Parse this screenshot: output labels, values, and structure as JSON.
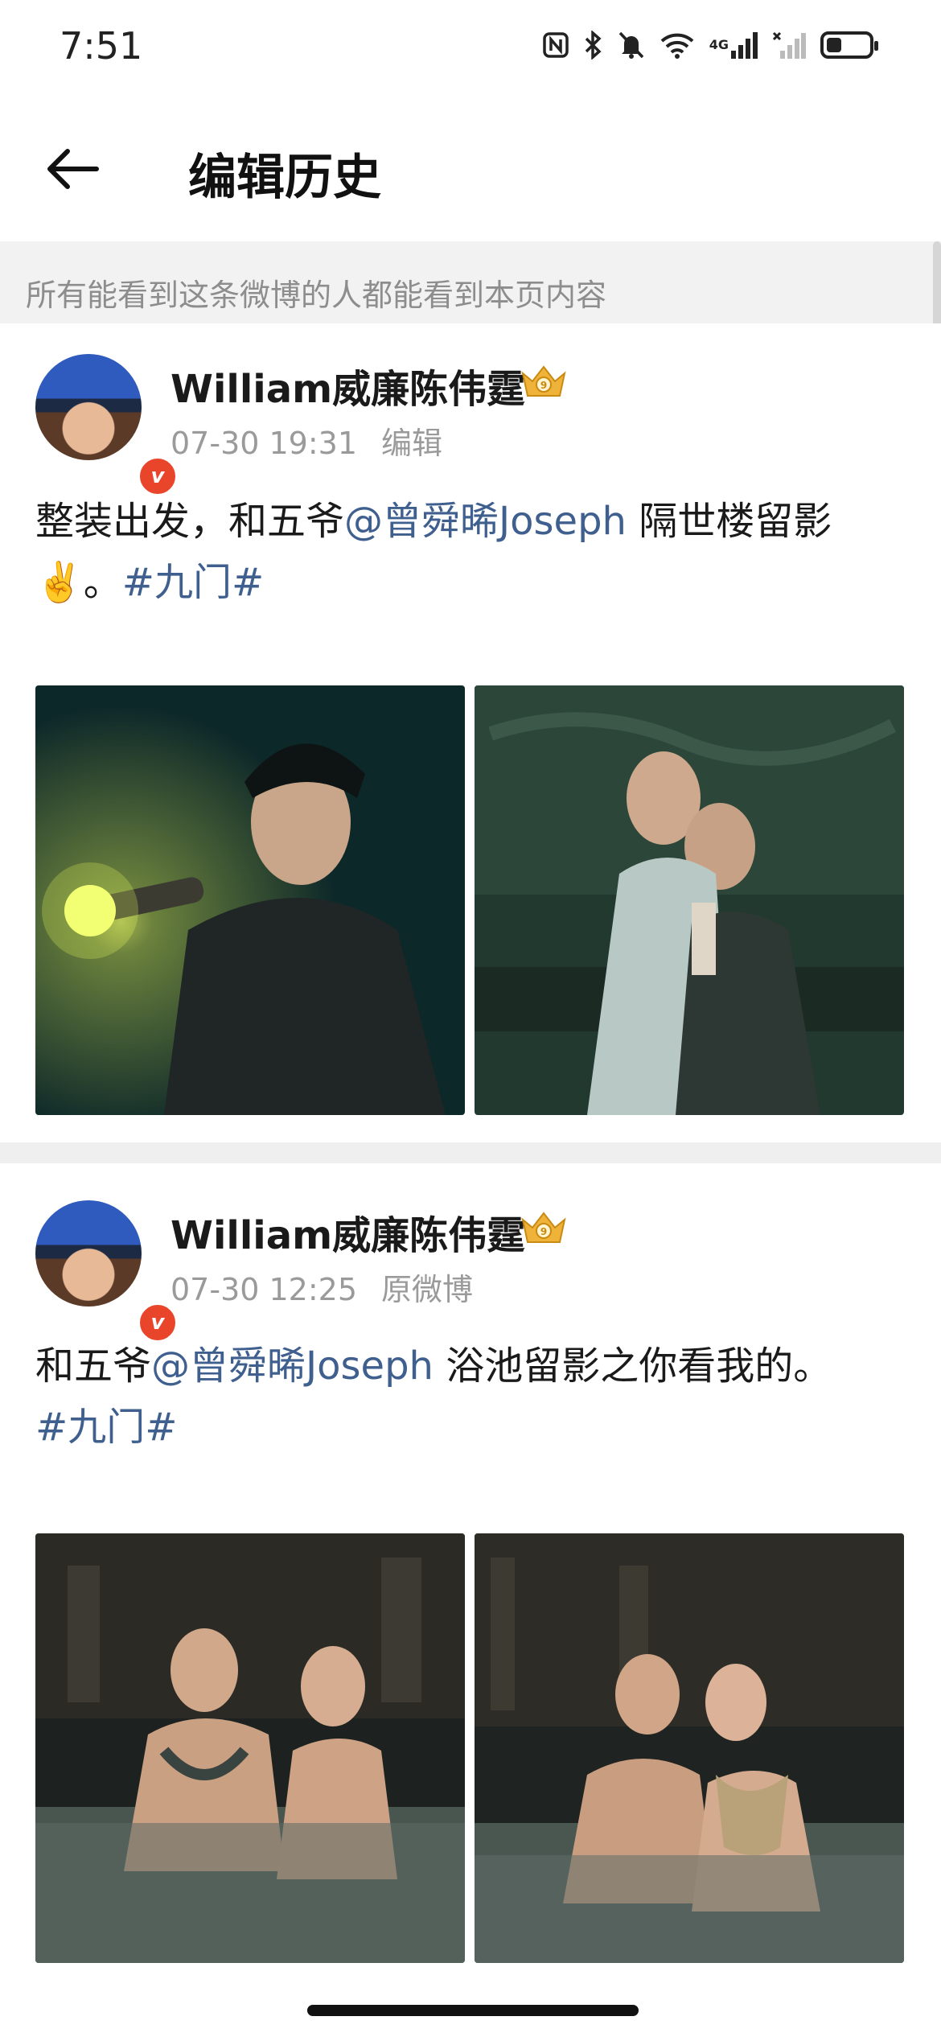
{
  "status_bar": {
    "time": "7:51",
    "icons": [
      "nfc-icon",
      "bluetooth-icon",
      "mute-icon",
      "wifi-icon",
      "signal-4g-icon",
      "signal-no-service-icon",
      "battery-icon"
    ],
    "network_label": "4G",
    "battery_level": 0.35
  },
  "header": {
    "title": "编辑历史",
    "back_icon": "back-arrow-icon"
  },
  "notice": {
    "text": "所有能看到这条微博的人都能看到本页内容"
  },
  "posts": [
    {
      "username": "William威廉陈伟霆",
      "time": "07-30 19:31",
      "label": "编辑",
      "text_1": "整装出发，和五爷",
      "mention": "@曾舜晞Joseph",
      "text_2": " 隔世楼留影",
      "emoji": "✌️",
      "text_3": "。",
      "hashtag": "#九门#",
      "photos": [
        "flashlight-portrait-photo",
        "two-actors-chair-photo"
      ]
    },
    {
      "username": "William威廉陈伟霆",
      "time": "07-30 12:25",
      "label": "原微博",
      "text_1": "和五爷",
      "mention": "@曾舜晞Joseph",
      "text_2": " 浴池留影之你看我的。",
      "hashtag": "#九门#",
      "photos": [
        "bath-pool-photo-1",
        "bath-pool-photo-2"
      ]
    }
  ],
  "colors": {
    "link": "#3f5f8f",
    "meta": "#9a9a9a",
    "notice_bg": "#f2f2f2",
    "vip_badge": "#e9452a"
  }
}
